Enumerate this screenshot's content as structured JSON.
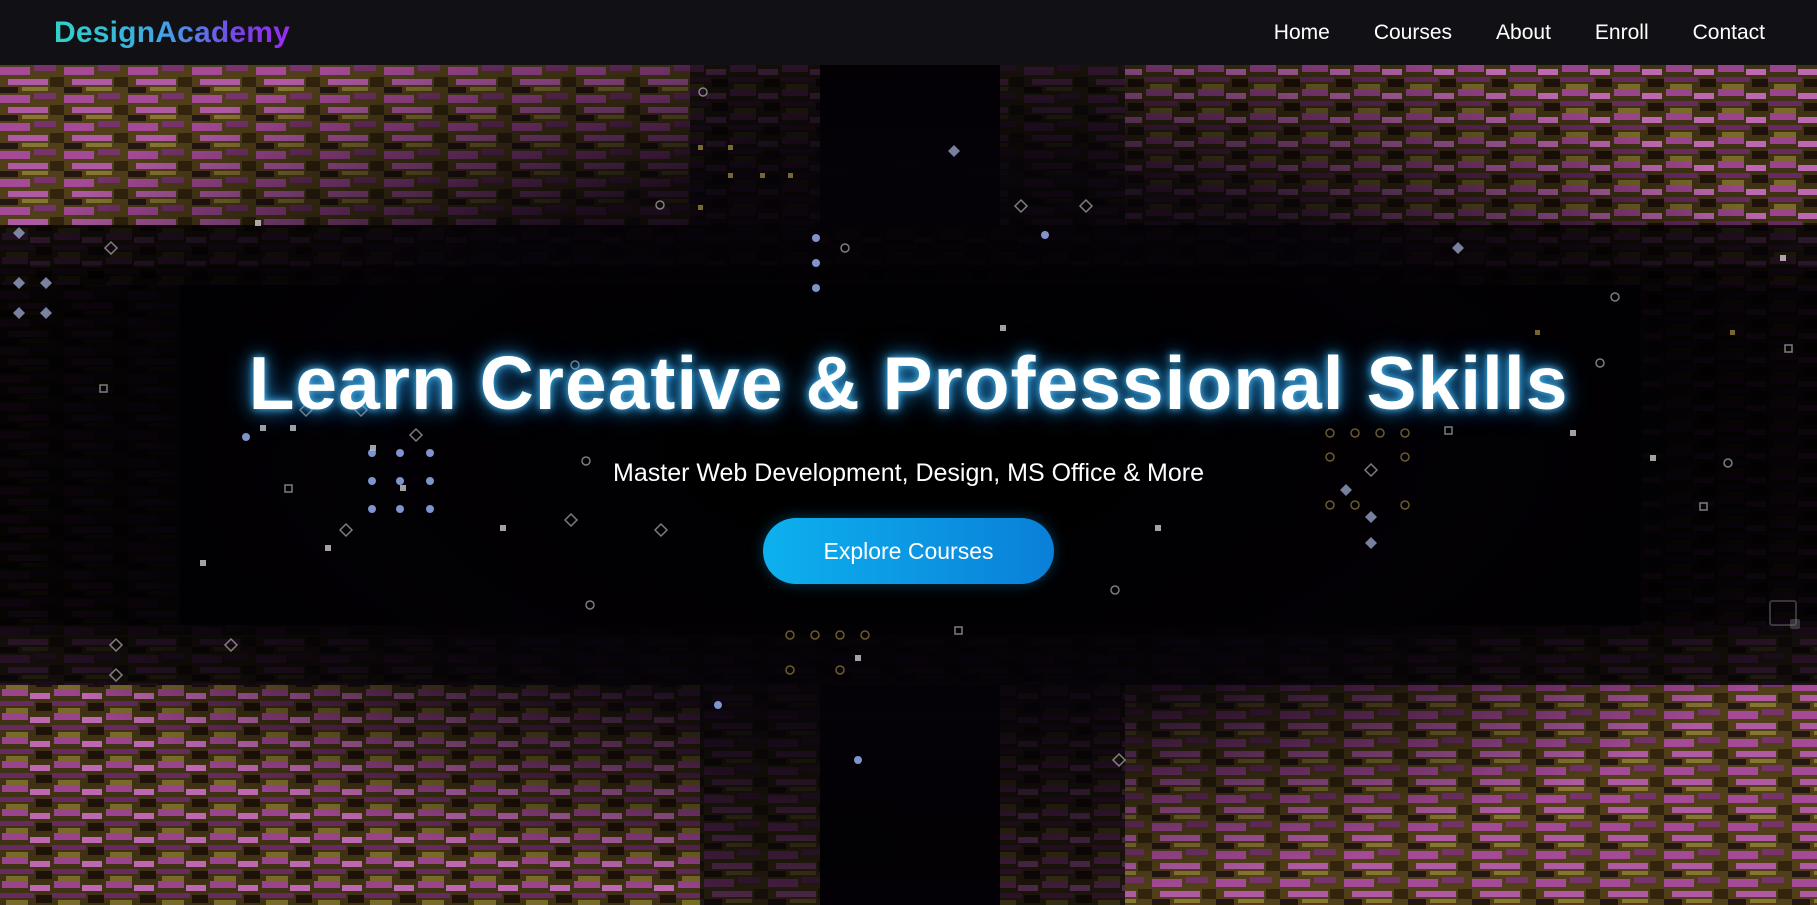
{
  "brand": {
    "name": "DesignAcademy"
  },
  "nav": {
    "items": [
      {
        "label": "Home"
      },
      {
        "label": "Courses"
      },
      {
        "label": "About"
      },
      {
        "label": "Enroll"
      },
      {
        "label": "Contact"
      }
    ]
  },
  "hero": {
    "title": "Learn Creative & Professional Skills",
    "subtitle": "Master Web Development, Design, MS Office & More",
    "cta_label": "Explore Courses",
    "background_icon": "digital-glitch-tunnel-video",
    "corner_icon": "picture-in-picture-icon"
  },
  "colors": {
    "navbar_bg": "#111015",
    "logo_gradient_start": "#2fd3c6",
    "logo_gradient_end": "#9a2cf0",
    "cta_start": "#0db1ee",
    "cta_end": "#0a7fd8",
    "tunnel_pink": "#b84aa8",
    "tunnel_olive": "#6b5a1e"
  }
}
